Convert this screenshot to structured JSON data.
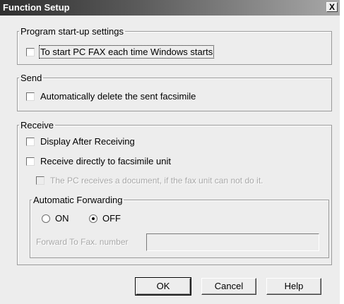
{
  "dialog": {
    "title": "Function Setup",
    "close_label": "X"
  },
  "startup": {
    "legend": "Program start-up settings",
    "start_pcfax_label": "To start PC FAX each time Windows starts",
    "start_pcfax_checked": false
  },
  "send": {
    "legend": "Send",
    "auto_delete_label": "Automatically delete the sent facsimile",
    "auto_delete_checked": false
  },
  "receive": {
    "legend": "Receive",
    "display_after_label": "Display After Receiving",
    "display_after_checked": false,
    "receive_directly_label": "Receive directly to facsimile unit",
    "receive_directly_checked": false,
    "pc_receives_label": "The PC receives a document, if the fax unit can not do it.",
    "pc_receives_checked": false,
    "forwarding": {
      "legend": "Automatic Forwarding",
      "on_label": "ON",
      "off_label": "OFF",
      "selected": "OFF",
      "forward_number_label": "Forward To Fax. number",
      "forward_number_value": ""
    }
  },
  "buttons": {
    "ok": "OK",
    "cancel": "Cancel",
    "help": "Help"
  }
}
